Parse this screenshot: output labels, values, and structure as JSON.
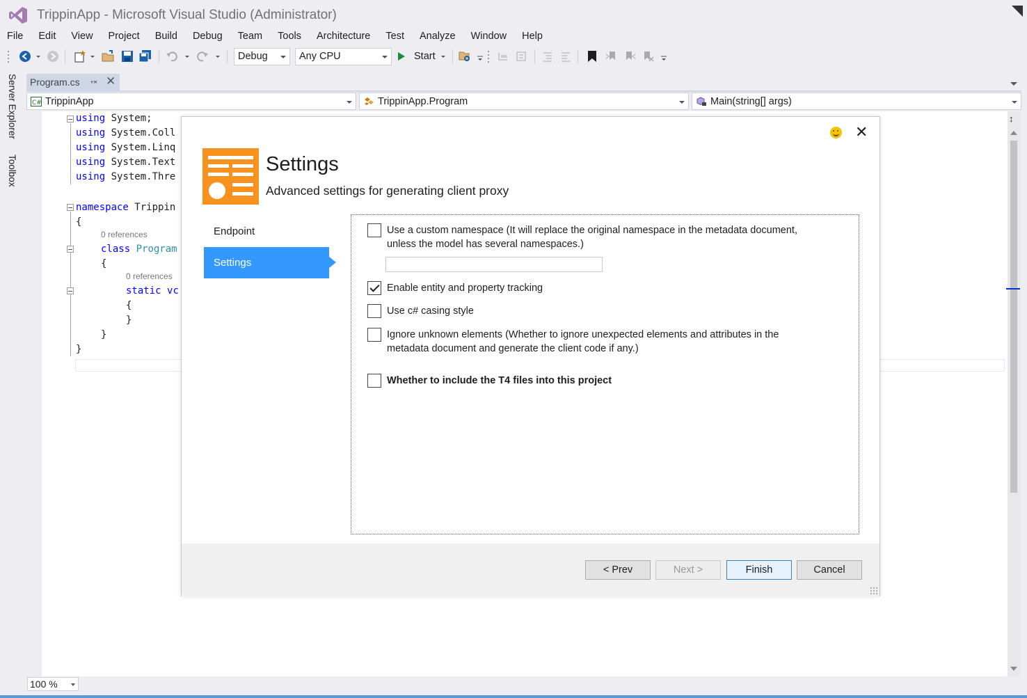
{
  "window": {
    "title": "TrippinApp - Microsoft Visual Studio (Administrator)"
  },
  "menu": [
    "File",
    "Edit",
    "View",
    "Project",
    "Build",
    "Debug",
    "Team",
    "Tools",
    "Architecture",
    "Test",
    "Analyze",
    "Window",
    "Help"
  ],
  "toolbar": {
    "configuration": "Debug",
    "platform": "Any CPU",
    "start_label": "Start"
  },
  "side_tabs": {
    "server_explorer": "Server Explorer",
    "toolbox": "Toolbox"
  },
  "doc_tab": {
    "label": "Program.cs"
  },
  "navbar": {
    "project": "TrippinApp",
    "type": "TrippinApp.Program",
    "member": "Main(string[] args)"
  },
  "code": {
    "using_kw": "using",
    "using_lines": [
      "System;",
      "System.Coll",
      "System.Linq",
      "System.Text",
      "System.Thre"
    ],
    "namespace_kw": "namespace",
    "namespace_name": "Trippin",
    "open_brace": "{",
    "close_brace": "}",
    "ref_label": "0 references",
    "class_kw": "class",
    "class_name": "Program",
    "static_kw": "static",
    "method_frag": "vc"
  },
  "zoom": {
    "level": "100 %"
  },
  "dialog": {
    "title": "Settings",
    "subtitle": "Advanced settings for generating client proxy",
    "nav": [
      {
        "label": "Endpoint",
        "active": false
      },
      {
        "label": "Settings",
        "active": true
      }
    ],
    "options": {
      "custom_namespace": {
        "label": "Use a custom namespace (It will replace the original namespace in the metadata document, unless the model has several namespaces.)",
        "checked": false,
        "value": ""
      },
      "tracking": {
        "label": "Enable entity and property tracking",
        "checked": true
      },
      "casing": {
        "label": "Use c# casing style",
        "checked": false
      },
      "ignore_unknown": {
        "label": "Ignore unknown elements (Whether to ignore unexpected elements and attributes in the metadata document and generate the client code if any.)",
        "checked": false
      },
      "t4": {
        "label": "Whether to include the T4 files into this project",
        "checked": false
      }
    },
    "buttons": {
      "prev": "< Prev",
      "next": "Next >",
      "finish": "Finish",
      "cancel": "Cancel"
    }
  },
  "colors": {
    "accent": "#3399ff",
    "icon_orange": "#f7921e",
    "keyword": "#0000ff",
    "type": "#2b91af"
  }
}
